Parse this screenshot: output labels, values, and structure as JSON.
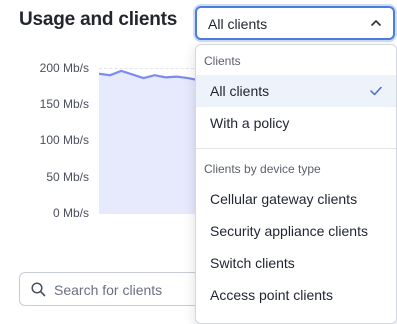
{
  "header": {
    "title": "Usage and clients",
    "select_value": "All clients"
  },
  "chart_data": {
    "type": "area",
    "title": "",
    "xlabel": "",
    "ylabel": "",
    "y_ticks": [
      "200 Mb/s",
      "150 Mb/s",
      "100 Mb/s",
      "50 Mb/s",
      "0 Mb/s"
    ],
    "ylim": [
      0,
      200
    ],
    "series": [
      {
        "values": [
          192,
          190,
          196,
          191,
          186,
          190,
          187,
          188,
          186,
          183
        ]
      }
    ],
    "colors": {
      "line": "#7b8cf0",
      "fill": "#e7e9fd"
    }
  },
  "dropdown": {
    "group1_label": "Clients",
    "group1_options": [
      "All clients",
      "With a policy"
    ],
    "selected": "All clients",
    "group2_label": "Clients by device type",
    "group2_options": [
      "Cellular gateway clients",
      "Security appliance clients",
      "Switch clients",
      "Access point clients"
    ]
  },
  "search": {
    "placeholder": "Search for clients"
  }
}
